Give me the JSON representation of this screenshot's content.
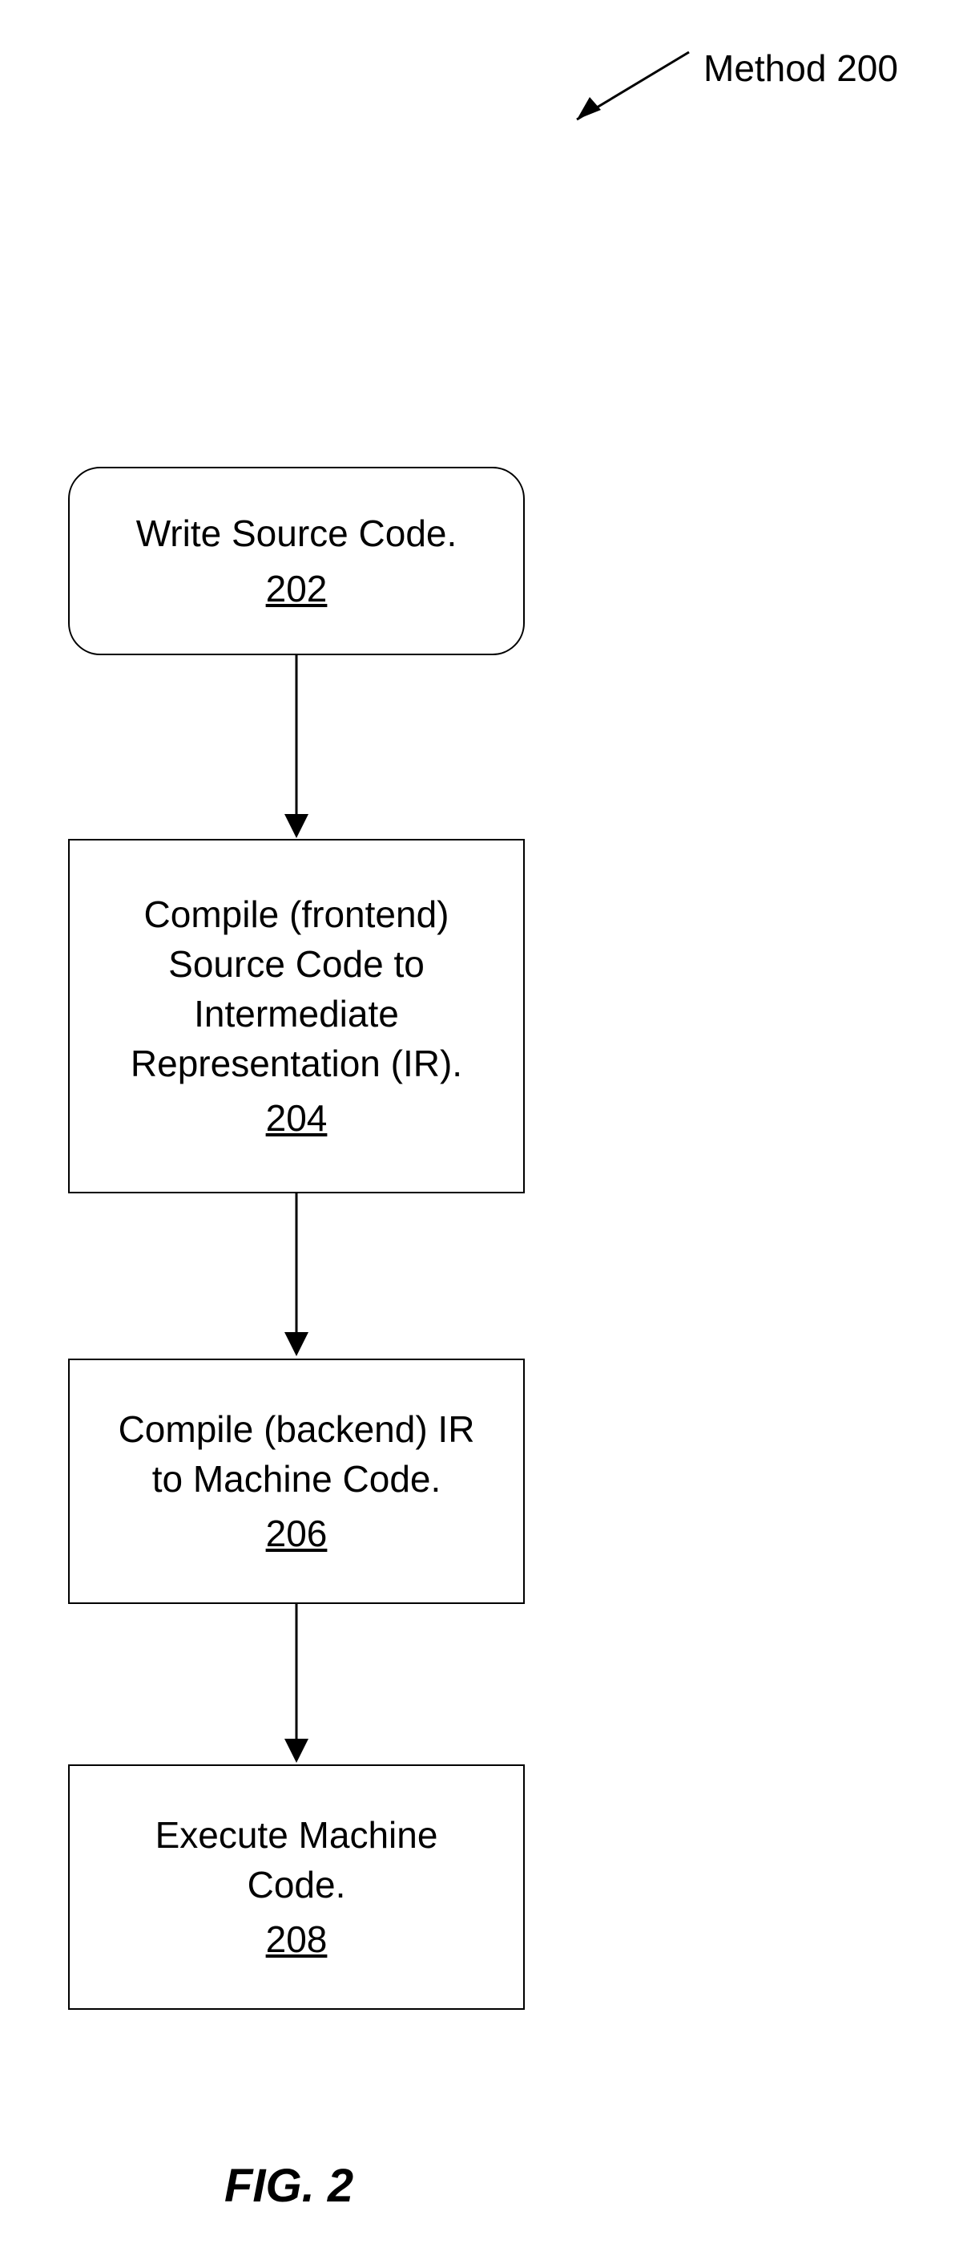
{
  "method_label": "Method 200",
  "figure_caption": "FIG. 2",
  "steps": {
    "write_source": {
      "text": "Write Source Code.",
      "ref": "202"
    },
    "compile_frontend": {
      "line1": "Compile (frontend)",
      "line2": "Source Code to",
      "line3": "Intermediate",
      "line4": "Representation (IR).",
      "ref": "204"
    },
    "compile_backend": {
      "line1": "Compile (backend) IR",
      "line2": "to Machine Code.",
      "ref": "206"
    },
    "execute": {
      "line1": "Execute Machine",
      "line2": "Code.",
      "ref": "208"
    }
  }
}
